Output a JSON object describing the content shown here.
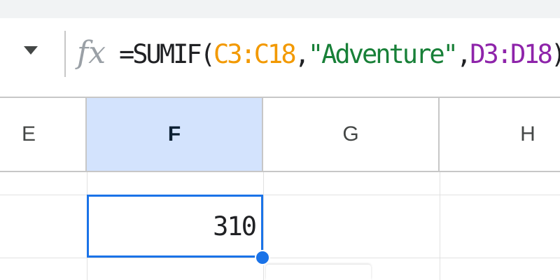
{
  "formula_bar": {
    "fx_label": "fx",
    "formula_parts": {
      "prefix": "=SUMIF(",
      "range1": "C3:C18",
      "comma1": ",",
      "criteria": "\"Adventure\"",
      "comma2": ",",
      "range2": "D3:D18",
      "suffix": ")"
    }
  },
  "columns": [
    {
      "label": "E"
    },
    {
      "label": "F"
    },
    {
      "label": "G"
    },
    {
      "label": "H"
    }
  ],
  "active_cell": {
    "column": "F",
    "value": "310"
  },
  "colors": {
    "selection_blue": "#1a73e8",
    "selected_header": "#d3e3fd",
    "range1_color": "#f29900",
    "string_color": "#188038",
    "range2_color": "#8e24aa"
  }
}
